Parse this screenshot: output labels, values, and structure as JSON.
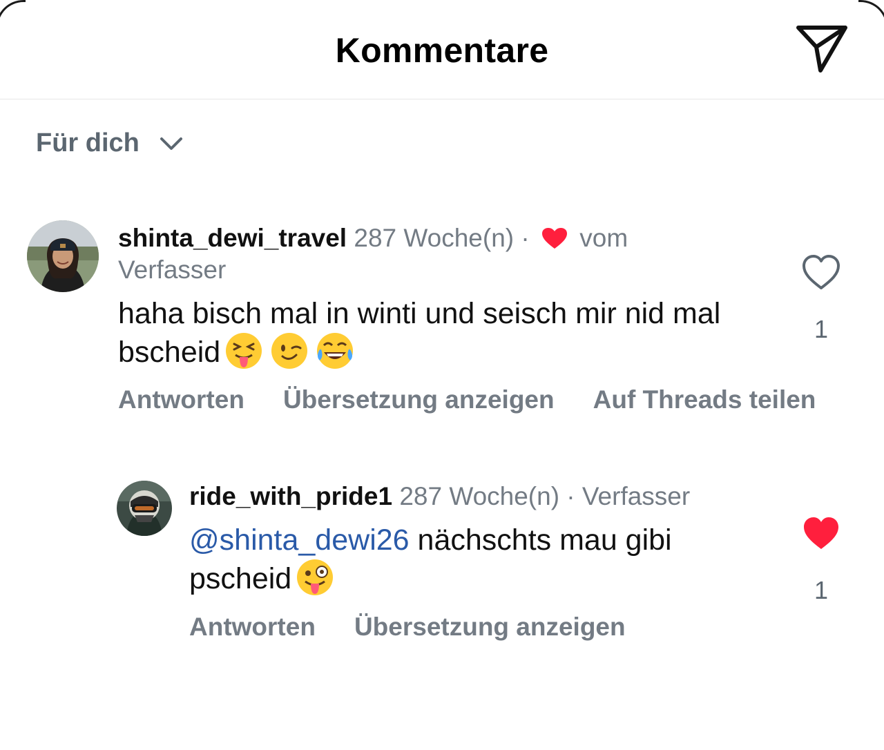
{
  "header": {
    "title": "Kommentare",
    "share_icon": "paper-plane-icon"
  },
  "filter": {
    "label": "Für dich",
    "icon": "chevron-down-icon"
  },
  "comments": [
    {
      "username": "shinta_dewi_travel",
      "time": "287 Woche(n) ·",
      "liked_by_author_prefix": "vom",
      "liked_by_author_suffix": "Verfasser",
      "text": "haha bisch mal in winti und seisch mir nid mal bscheid",
      "emojis": [
        "squinting-tongue-emoji",
        "winking-emoji",
        "tears-of-joy-emoji"
      ],
      "actions": [
        "Antworten",
        "Übersetzung anzeigen",
        "Auf Threads teilen"
      ],
      "liked": false,
      "like_count": "1"
    },
    {
      "username": "ride_with_pride1",
      "time": "287 Woche(n) · Verfasser",
      "mention": "@shinta_dewi26",
      "text": "nächschts mau gibi pscheid",
      "emojis": [
        "zany-face-emoji"
      ],
      "actions": [
        "Antworten",
        "Übersetzung anzeigen"
      ],
      "liked": true,
      "like_count": "1"
    }
  ],
  "colors": {
    "heart_red": "#ff1f3d",
    "muted_text": "#737b84",
    "mention_blue": "#2a5aa8"
  }
}
